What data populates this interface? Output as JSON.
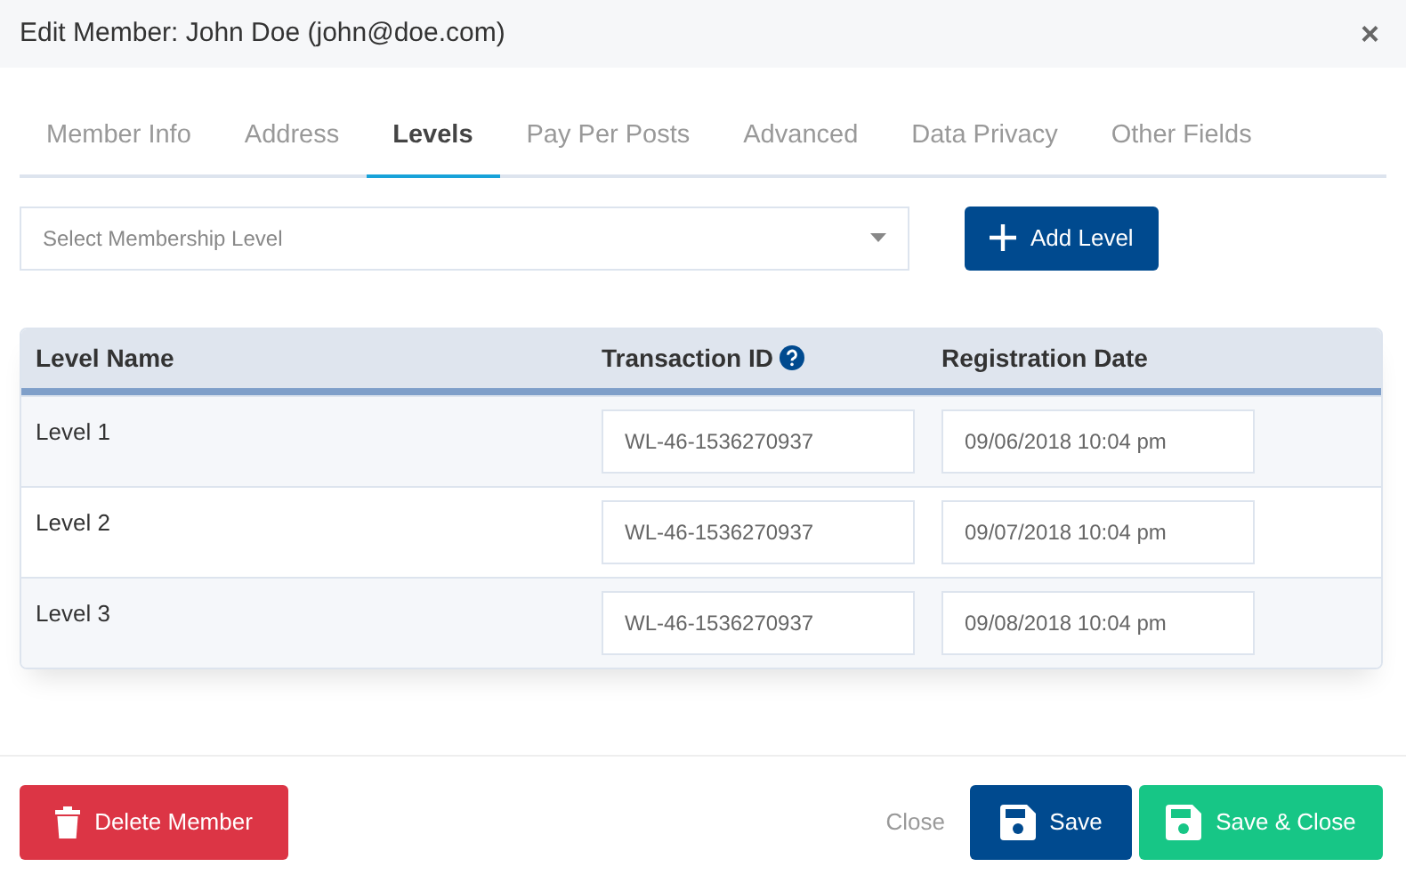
{
  "window": {
    "title": "Edit Member: John Doe (john@doe.com)",
    "close": "×"
  },
  "tabs": [
    {
      "label": "Member Info",
      "selected": false
    },
    {
      "label": "Address",
      "selected": false
    },
    {
      "label": "Levels",
      "selected": true
    },
    {
      "label": "Pay Per Posts",
      "selected": false
    },
    {
      "label": "Advanced",
      "selected": false
    },
    {
      "label": "Data Privacy",
      "selected": false
    },
    {
      "label": "Other Fields",
      "selected": false
    }
  ],
  "level_select": {
    "placeholder": "Select Membership Level"
  },
  "add_button": {
    "label": "Add Level"
  },
  "table": {
    "columns": [
      "Level Name",
      "Transaction ID",
      "Registration Date"
    ],
    "rows": [
      {
        "name": "Level 1",
        "transaction_id": "WL-46-1536270937",
        "date": "09/06/2018 10:04 pm"
      },
      {
        "name": "Level 2",
        "transaction_id": "WL-46-1536270937",
        "date": "09/07/2018 10:04 pm"
      },
      {
        "name": "Level 3",
        "transaction_id": "WL-46-1536270937",
        "date": "09/08/2018 10:04 pm"
      }
    ]
  },
  "footer": {
    "left": [
      {
        "kind": "delete",
        "label": "Delete Member"
      }
    ],
    "right": [
      {
        "kind": "link",
        "label": "Close"
      },
      {
        "kind": "save",
        "label": "Save"
      },
      {
        "kind": "saveclose",
        "label": "Save & Close"
      }
    ]
  }
}
